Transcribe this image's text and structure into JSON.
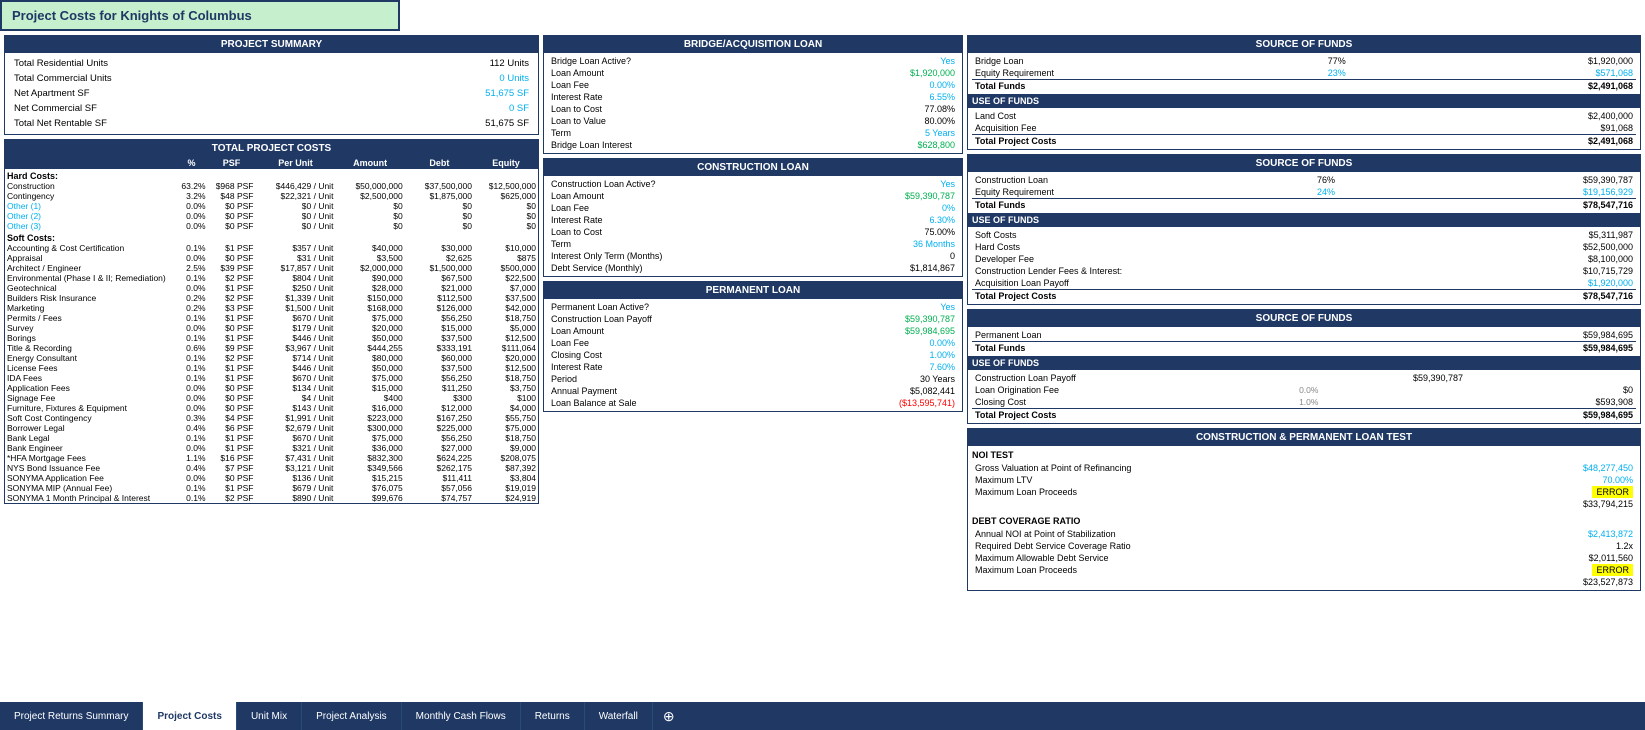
{
  "page_title": "Project Costs for Knights of Columbus",
  "project_summary": {
    "header": "PROJECT SUMMARY",
    "rows": [
      {
        "label": "Total Residential Units",
        "value": "112 Units",
        "color": "black"
      },
      {
        "label": "Total Commercial Units",
        "value": "0 Units",
        "color": "blue"
      },
      {
        "label": "Net Apartment SF",
        "value": "51,675 SF",
        "color": "blue"
      },
      {
        "label": "Net Commercial SF",
        "value": "0 SF",
        "color": "blue"
      },
      {
        "label": "Total Net Rentable SF",
        "value": "51,675 SF",
        "color": "black"
      }
    ]
  },
  "total_project_costs": {
    "header": "TOTAL PROJECT COSTS",
    "columns": [
      "",
      "%",
      "PSF",
      "Per Unit",
      "Amount",
      "Debt",
      "Equity"
    ],
    "hard_costs_label": "Hard Costs:",
    "rows_hard": [
      {
        "label": "Construction",
        "pct": "63.2%",
        "psf": "$968 PSF",
        "per_unit": "$446,429 / Unit",
        "amount": "$50,000,000",
        "debt": "$37,500,000",
        "equity": "$12,500,000"
      },
      {
        "label": "Contingency",
        "pct": "3.2%",
        "psf": "$48 PSF",
        "per_unit": "$22,321 / Unit",
        "amount": "$2,500,000",
        "debt": "$1,875,000",
        "equity": "$625,000"
      },
      {
        "label": "Other (1)",
        "pct": "0.0%",
        "psf": "$0 PSF",
        "per_unit": "$0 / Unit",
        "amount": "$0",
        "debt": "$0",
        "equity": "$0"
      },
      {
        "label": "Other (2)",
        "pct": "0.0%",
        "psf": "$0 PSF",
        "per_unit": "$0 / Unit",
        "amount": "$0",
        "debt": "$0",
        "equity": "$0"
      },
      {
        "label": "Other (3)",
        "pct": "0.0%",
        "psf": "$0 PSF",
        "per_unit": "$0 / Unit",
        "amount": "$0",
        "debt": "$0",
        "equity": "$0"
      }
    ],
    "soft_costs_label": "Soft Costs:",
    "rows_soft": [
      {
        "label": "Accounting & Cost Certification",
        "pct": "0.1%",
        "psf": "$1 PSF",
        "per_unit": "$357 / Unit",
        "amount": "$40,000",
        "debt": "$30,000",
        "equity": "$10,000"
      },
      {
        "label": "Appraisal",
        "pct": "0.0%",
        "psf": "$0 PSF",
        "per_unit": "$31 / Unit",
        "amount": "$3,500",
        "debt": "$2,625",
        "equity": "$875"
      },
      {
        "label": "Architect / Engineer",
        "pct": "2.5%",
        "psf": "$39 PSF",
        "per_unit": "$17,857 / Unit",
        "amount": "$2,000,000",
        "debt": "$1,500,000",
        "equity": "$500,000"
      },
      {
        "label": "Environmental (Phase I & II; Remediation)",
        "pct": "0.1%",
        "psf": "$2 PSF",
        "per_unit": "$804 / Unit",
        "amount": "$90,000",
        "debt": "$67,500",
        "equity": "$22,500"
      },
      {
        "label": "Geotechnical",
        "pct": "0.0%",
        "psf": "$1 PSF",
        "per_unit": "$250 / Unit",
        "amount": "$28,000",
        "debt": "$21,000",
        "equity": "$7,000"
      },
      {
        "label": "Builders Risk Insurance",
        "pct": "0.2%",
        "psf": "$2 PSF",
        "per_unit": "$1,339 / Unit",
        "amount": "$150,000",
        "debt": "$112,500",
        "equity": "$37,500"
      },
      {
        "label": "Marketing",
        "pct": "0.2%",
        "psf": "$3 PSF",
        "per_unit": "$1,500 / Unit",
        "amount": "$168,000",
        "debt": "$126,000",
        "equity": "$42,000"
      },
      {
        "label": "Permits / Fees",
        "pct": "0.1%",
        "psf": "$1 PSF",
        "per_unit": "$670 / Unit",
        "amount": "$75,000",
        "debt": "$56,250",
        "equity": "$18,750"
      },
      {
        "label": "Survey",
        "pct": "0.0%",
        "psf": "$0 PSF",
        "per_unit": "$179 / Unit",
        "amount": "$20,000",
        "debt": "$15,000",
        "equity": "$5,000"
      },
      {
        "label": "Borings",
        "pct": "0.1%",
        "psf": "$1 PSF",
        "per_unit": "$446 / Unit",
        "amount": "$50,000",
        "debt": "$37,500",
        "equity": "$12,500"
      },
      {
        "label": "Title & Recording",
        "pct": "0.6%",
        "psf": "$9 PSF",
        "per_unit": "$3,967 / Unit",
        "amount": "$444,255",
        "debt": "$333,191",
        "equity": "$111,064"
      },
      {
        "label": "Energy Consultant",
        "pct": "0.1%",
        "psf": "$2 PSF",
        "per_unit": "$714 / Unit",
        "amount": "$80,000",
        "debt": "$60,000",
        "equity": "$20,000"
      },
      {
        "label": "License Fees",
        "pct": "0.1%",
        "psf": "$1 PSF",
        "per_unit": "$446 / Unit",
        "amount": "$50,000",
        "debt": "$37,500",
        "equity": "$12,500"
      },
      {
        "label": "IDA Fees",
        "pct": "0.1%",
        "psf": "$1 PSF",
        "per_unit": "$670 / Unit",
        "amount": "$75,000",
        "debt": "$56,250",
        "equity": "$18,750"
      },
      {
        "label": "Application Fees",
        "pct": "0.0%",
        "psf": "$0 PSF",
        "per_unit": "$134 / Unit",
        "amount": "$15,000",
        "debt": "$11,250",
        "equity": "$3,750"
      },
      {
        "label": "Signage Fee",
        "pct": "0.0%",
        "psf": "$0 PSF",
        "per_unit": "$4 / Unit",
        "amount": "$400",
        "debt": "$300",
        "equity": "$100"
      },
      {
        "label": "Furniture, Fixtures & Equipment",
        "pct": "0.0%",
        "psf": "$0 PSF",
        "per_unit": "$143 / Unit",
        "amount": "$16,000",
        "debt": "$12,000",
        "equity": "$4,000"
      },
      {
        "label": "Soft Cost Contingency",
        "pct": "0.3%",
        "psf": "$4 PSF",
        "per_unit": "$1,991 / Unit",
        "amount": "$223,000",
        "debt": "$167,250",
        "equity": "$55,750"
      },
      {
        "label": "Borrower Legal",
        "pct": "0.4%",
        "psf": "$6 PSF",
        "per_unit": "$2,679 / Unit",
        "amount": "$300,000",
        "debt": "$225,000",
        "equity": "$75,000"
      },
      {
        "label": "Bank Legal",
        "pct": "0.1%",
        "psf": "$1 PSF",
        "per_unit": "$670 / Unit",
        "amount": "$75,000",
        "debt": "$56,250",
        "equity": "$18,750"
      },
      {
        "label": "Bank Engineer",
        "pct": "0.0%",
        "psf": "$1 PSF",
        "per_unit": "$321 / Unit",
        "amount": "$36,000",
        "debt": "$27,000",
        "equity": "$9,000"
      },
      {
        "label": "*HFA Mortgage Fees",
        "pct": "1.1%",
        "psf": "$16 PSF",
        "per_unit": "$7,431 / Unit",
        "amount": "$832,300",
        "debt": "$624,225",
        "equity": "$208,075"
      },
      {
        "label": "NYS Bond Issuance Fee",
        "pct": "0.4%",
        "psf": "$7 PSF",
        "per_unit": "$3,121 / Unit",
        "amount": "$349,566",
        "debt": "$262,175",
        "equity": "$87,392"
      },
      {
        "label": "SONYMA Application Fee",
        "pct": "0.0%",
        "psf": "$0 PSF",
        "per_unit": "$136 / Unit",
        "amount": "$15,215",
        "debt": "$11,411",
        "equity": "$3,804"
      },
      {
        "label": "SONYMA MIP (Annual Fee)",
        "pct": "0.1%",
        "psf": "$1 PSF",
        "per_unit": "$679 / Unit",
        "amount": "$76,075",
        "debt": "$57,056",
        "equity": "$19,019"
      },
      {
        "label": "SONYMA 1 Month Principal & Interest",
        "pct": "0.1%",
        "psf": "$2 PSF",
        "per_unit": "$890 / Unit",
        "amount": "$99,676",
        "debt": "$74,757",
        "equity": "$24,919"
      }
    ]
  },
  "bridge_loan": {
    "header": "BRIDGE/ACQUISITION LOAN",
    "rows": [
      {
        "label": "Bridge Loan Active?",
        "value": "Yes",
        "color": "blue"
      },
      {
        "label": "Loan Amount",
        "value": "$1,920,000",
        "color": "green"
      },
      {
        "label": "Loan Fee",
        "value": "0.00%",
        "color": "blue"
      },
      {
        "label": "Interest Rate",
        "value": "6.55%",
        "color": "blue"
      },
      {
        "label": "Loan to Cost",
        "value": "77.08%",
        "color": "black"
      },
      {
        "label": "Loan to Value",
        "value": "80.00%",
        "color": "black"
      },
      {
        "label": "Term",
        "value": "5 Years",
        "color": "blue"
      },
      {
        "label": "Bridge Loan Interest",
        "value": "$628,800",
        "color": "green"
      }
    ]
  },
  "construction_loan": {
    "header": "CONSTRUCTION LOAN",
    "rows": [
      {
        "label": "Construction Loan Active?",
        "value": "Yes",
        "color": "blue"
      },
      {
        "label": "Loan Amount",
        "value": "$59,390,787",
        "color": "green"
      },
      {
        "label": "Loan Fee",
        "value": "0%",
        "color": "blue"
      },
      {
        "label": "Interest Rate",
        "value": "6.30%",
        "color": "blue"
      },
      {
        "label": "Loan to Cost",
        "value": "75.00%",
        "color": "black"
      },
      {
        "label": "Term",
        "value": "36 Months",
        "color": "blue"
      },
      {
        "label": "Interest Only Term (Months)",
        "value": "0",
        "color": "black"
      },
      {
        "label": "Debt Service (Monthly)",
        "value": "$1,814,867",
        "color": "black"
      }
    ]
  },
  "permanent_loan": {
    "header": "PERMANENT LOAN",
    "rows": [
      {
        "label": "Permanent Loan Active?",
        "value": "Yes",
        "color": "blue"
      },
      {
        "label": "Construction Loan Payoff",
        "value": "$59,390,787",
        "color": "green"
      },
      {
        "label": "Loan Amount",
        "value": "$59,984,695",
        "color": "green"
      },
      {
        "label": "Loan Fee",
        "value": "0.00%",
        "color": "blue"
      },
      {
        "label": "Closing Cost",
        "value": "1.00%",
        "color": "blue"
      },
      {
        "label": "Interest Rate",
        "value": "7.60%",
        "color": "blue"
      },
      {
        "label": "Period",
        "value": "30 Years",
        "color": "black"
      },
      {
        "label": "Annual Payment",
        "value": "$5,082,441",
        "color": "black"
      },
      {
        "label": "Loan Balance at Sale",
        "value": "($13,595,741)",
        "color": "red"
      }
    ]
  },
  "source_funds_bridge": {
    "header": "SOURCE OF FUNDS",
    "rows_source": [
      {
        "label": "Bridge Loan",
        "pct": "77%",
        "value": "$1,920,000"
      },
      {
        "label": "Equity Requirement",
        "pct": "23%",
        "value": "$571,068",
        "color": "blue"
      },
      {
        "label": "Total Funds",
        "value": "$2,491,068",
        "bold": true
      }
    ],
    "use_header": "USE OF FUNDS",
    "rows_use": [
      {
        "label": "Land Cost",
        "value": "$2,400,000"
      },
      {
        "label": "Acquisition Fee",
        "value": "$91,068"
      },
      {
        "label": "Total Project Costs",
        "value": "$2,491,068",
        "bold": true
      }
    ]
  },
  "source_funds_construction": {
    "header": "SOURCE OF FUNDS",
    "rows_source": [
      {
        "label": "Construction Loan",
        "pct": "76%",
        "value": "$59,390,787"
      },
      {
        "label": "Equity Requirement",
        "pct": "24%",
        "value": "$19,156,929",
        "color": "blue"
      },
      {
        "label": "Total Funds",
        "value": "$78,547,716",
        "bold": true
      }
    ],
    "use_header": "USE OF FUNDS",
    "rows_use": [
      {
        "label": "Soft Costs",
        "value": "$5,311,987"
      },
      {
        "label": "Hard Costs",
        "value": "$52,500,000"
      },
      {
        "label": "Developer Fee",
        "value": "$8,100,000"
      },
      {
        "label": "Construction Lender Fees & Interest:",
        "value": "$10,715,729"
      },
      {
        "label": "Acquisition Loan Payoff",
        "value": "$1,920,000",
        "color": "blue"
      },
      {
        "label": "Total Project Costs",
        "value": "$78,547,716",
        "bold": true
      }
    ]
  },
  "source_funds_permanent": {
    "header": "SOURCE OF FUNDS",
    "rows_source": [
      {
        "label": "Permanent Loan",
        "value": "$59,984,695"
      },
      {
        "label": "Total Funds",
        "value": "$59,984,695",
        "bold": true
      }
    ],
    "use_header": "USE OF FUNDS",
    "rows_use": [
      {
        "label": "Construction Loan Payoff",
        "value": "$59,390,787"
      },
      {
        "label": "Loan Origination Fee",
        "pct": "0.0%",
        "value": "$0"
      },
      {
        "label": "Closing Cost",
        "pct": "1.0%",
        "value": "$593,908"
      },
      {
        "label": "Total Project Costs",
        "value": "$59,984,695",
        "bold": true
      }
    ]
  },
  "loan_test": {
    "header": "CONSTRUCTION & PERMANENT LOAN TEST",
    "noi_header": "NOI TEST",
    "noi_rows": [
      {
        "label": "Gross Valuation at Point of Refinancing",
        "value": "$48,277,450",
        "color": "blue"
      },
      {
        "label": "Maximum LTV",
        "value": "70.00%",
        "color": "blue"
      },
      {
        "label": "Maximum Loan Proceeds",
        "value": "ERROR",
        "error": true
      },
      {
        "label": "",
        "value": "$33,794,215",
        "color": "black"
      }
    ],
    "dcr_header": "DEBT COVERAGE RATIO",
    "dcr_rows": [
      {
        "label": "Annual NOI at Point of Stabilization",
        "value": "$2,413,872",
        "color": "blue"
      },
      {
        "label": "Required Debt Service Coverage Ratio",
        "value": "1.2x",
        "color": "black"
      },
      {
        "label": "Maximum Allowable Debt Service",
        "value": "$2,011,560",
        "color": "black"
      },
      {
        "label": "Maximum Loan Proceeds",
        "value": "ERROR",
        "error": true
      },
      {
        "label": "",
        "value": "$23,527,873",
        "color": "black"
      }
    ]
  },
  "tabs": [
    {
      "label": "Project Returns Summary",
      "active": false
    },
    {
      "label": "Project Costs",
      "active": true
    },
    {
      "label": "Unit Mix",
      "active": false
    },
    {
      "label": "Project Analysis",
      "active": false
    },
    {
      "label": "Monthly Cash Flows",
      "active": false
    },
    {
      "label": "Returns",
      "active": false
    },
    {
      "label": "Waterfall",
      "active": false
    }
  ]
}
